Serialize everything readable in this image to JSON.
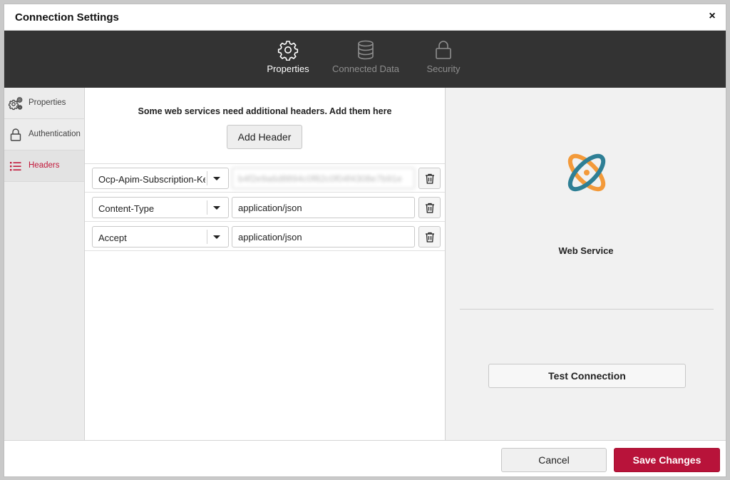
{
  "dialog": {
    "title": "Connection Settings",
    "close_glyph": "×"
  },
  "topnav": {
    "items": [
      {
        "label": "Properties",
        "icon": "gear-icon",
        "active": true
      },
      {
        "label": "Connected Data",
        "icon": "database-icon",
        "active": false
      },
      {
        "label": "Security",
        "icon": "lock-icon",
        "active": false
      }
    ]
  },
  "sidebar": {
    "items": [
      {
        "label": "Properties",
        "icon": "gears-icon",
        "active": false
      },
      {
        "label": "Authentication",
        "icon": "lock-icon",
        "active": false
      },
      {
        "label": "Headers",
        "icon": "list-icon",
        "active": true
      }
    ]
  },
  "headers": {
    "hint": "Some web services need additional headers. Add them here",
    "add_label": "Add Header",
    "rows": [
      {
        "name": "Ocp-Apim-Subscription-Key",
        "value": "b4f2e9a6d8894c0f82c0f04f4308e7b91e",
        "masked": true
      },
      {
        "name": "Content-Type",
        "value": "application/json",
        "masked": false
      },
      {
        "name": "Accept",
        "value": "application/json",
        "masked": false
      }
    ]
  },
  "service": {
    "name": "Web Service",
    "test_label": "Test Connection",
    "logo_colors": {
      "orange": "#f39a3a",
      "teal": "#2e7f95"
    }
  },
  "footer": {
    "cancel_label": "Cancel",
    "save_label": "Save Changes"
  },
  "colors": {
    "accent": "#b8133a",
    "nav_bg": "#333333"
  }
}
